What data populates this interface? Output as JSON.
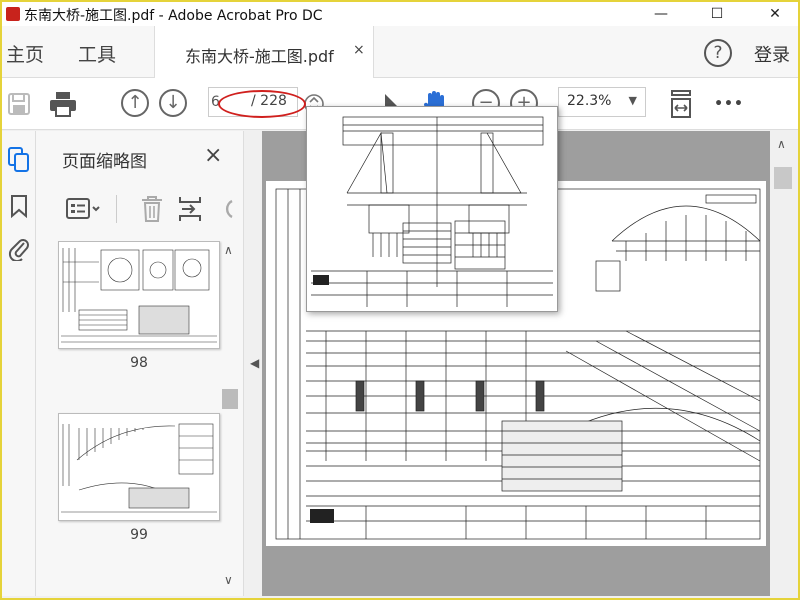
{
  "window": {
    "title": "东南大桥-施工图.pdf - Adobe Acrobat Pro DC",
    "minimize": "—",
    "maximize": "☐",
    "close": "✕"
  },
  "nav": {
    "home": "主页",
    "tools": "工具",
    "doc_tab": "东南大桥-施工图.pdf",
    "doc_tab_close": "×",
    "help": "?",
    "login": "登录"
  },
  "toolbar": {
    "current_page": "6",
    "total_pages": "/ 228",
    "zoom": "22.3%",
    "more": "•••"
  },
  "panel": {
    "title": "页面缩略图",
    "close": "×",
    "thumbnails": [
      {
        "page": "98"
      },
      {
        "page": "99"
      }
    ]
  },
  "colors": {
    "accent_blue": "#1473e6",
    "annotation_red": "#d0201e",
    "frame_yellow": "#e5d33a"
  }
}
